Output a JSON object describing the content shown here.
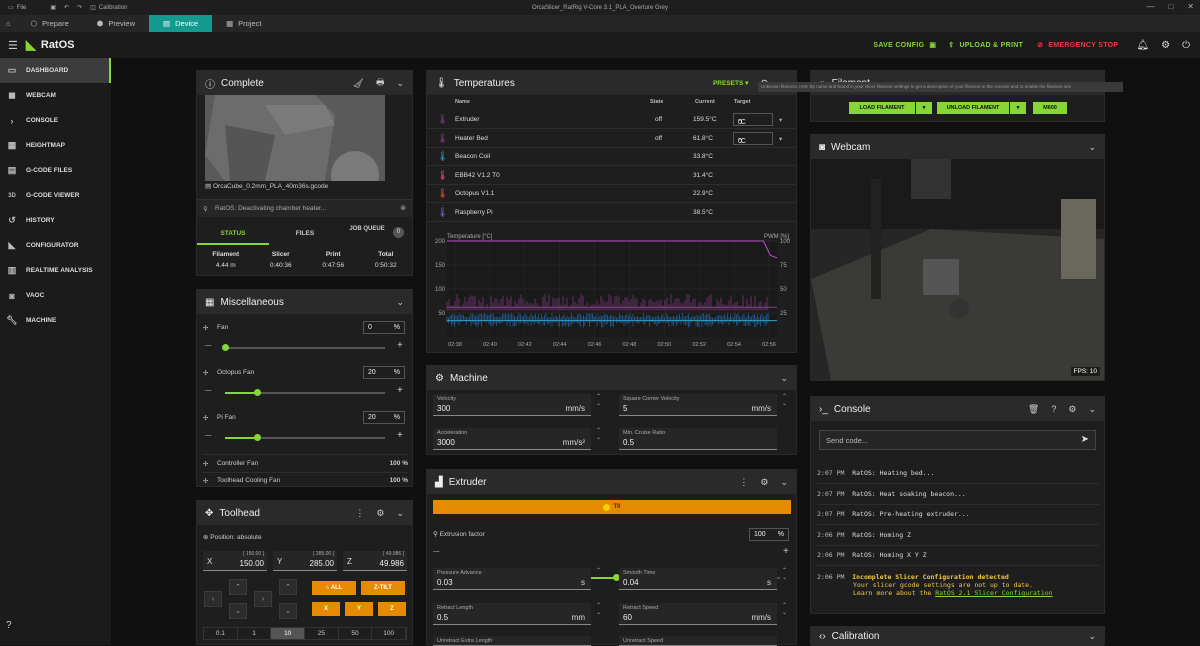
{
  "titlebar": {
    "file": "File",
    "calibration": "Calibration",
    "title": "OrcaSlicer_RatRig V-Core 3.1_PLA_Overture Grey"
  },
  "tabs": [
    {
      "label": "Prepare"
    },
    {
      "label": "Preview"
    },
    {
      "label": "Device"
    },
    {
      "label": "Project"
    }
  ],
  "app": {
    "name": "RatOS",
    "save_config": "SAVE CONFIG",
    "upload_print": "UPLOAD & PRINT",
    "emergency_stop": "EMERGENCY STOP"
  },
  "nav": [
    {
      "label": "DASHBOARD",
      "icon": "dashboard-icon"
    },
    {
      "label": "WEBCAM",
      "icon": "webcam-icon"
    },
    {
      "label": "CONSOLE",
      "icon": "console-icon"
    },
    {
      "label": "HEIGHTMAP",
      "icon": "heightmap-icon"
    },
    {
      "label": "G-CODE FILES",
      "icon": "file-icon"
    },
    {
      "label": "G-CODE VIEWER",
      "icon": "3d-icon"
    },
    {
      "label": "HISTORY",
      "icon": "history-icon"
    },
    {
      "label": "CONFIGURATOR",
      "icon": "configurator-icon"
    },
    {
      "label": "REALTIME ANALYSIS",
      "icon": "analysis-icon"
    },
    {
      "label": "VAOC",
      "icon": "vaoc-icon"
    },
    {
      "label": "MACHINE",
      "icon": "wrench-icon"
    }
  ],
  "status": {
    "title": "Complete",
    "filename": "OrcaCube_0.2mm_PLA_40m36s.gcode",
    "message": "RatOS: Deactivating chamber heater...",
    "tabs": [
      "STATUS",
      "FILES",
      "JOB QUEUE"
    ],
    "job_queue_count": "0",
    "stats": {
      "filament_label": "Filament",
      "filament": "4.44 m",
      "slicer_label": "Slicer",
      "slicer": "0:40:36",
      "print_label": "Print",
      "print": "0:47:56",
      "total_label": "Total",
      "total": "0:50:32"
    }
  },
  "misc": {
    "title": "Miscellaneous",
    "fans": [
      {
        "name": "Fan",
        "value": "0",
        "unit": "%",
        "level": 0
      },
      {
        "name": "Octopus Fan",
        "value": "20",
        "unit": "%",
        "level": 20
      },
      {
        "name": "Pi Fan",
        "value": "20",
        "unit": "%",
        "level": 20
      }
    ],
    "controller_fan": {
      "name": "Controller Fan",
      "value": "100 %"
    },
    "toolhead_fan": {
      "name": "Toolhead Cooling Fan",
      "value": "100 %"
    }
  },
  "toolhead": {
    "title": "Toolhead",
    "position_label": "Position: absolute",
    "axes": [
      {
        "axis": "X",
        "max": "[ 150.00 ]",
        "value": "150.00"
      },
      {
        "axis": "Y",
        "max": "[ 285.00 ]",
        "value": "285.00"
      },
      {
        "axis": "Z",
        "max": "[ 49.986 ]",
        "value": "49.986"
      }
    ],
    "home_all": "ALL",
    "ztilt": "Z-TILT",
    "home_x": "X",
    "home_y": "Y",
    "home_z": "Z",
    "steps": [
      "0.1",
      "1",
      "10",
      "25",
      "50",
      "100"
    ],
    "active_step": "10"
  },
  "temps": {
    "title": "Temperatures",
    "presets": "PRESETS",
    "headers": {
      "name": "Name",
      "state": "State",
      "current": "Current",
      "target": "Target"
    },
    "rows": [
      {
        "name": "Extruder",
        "state": "off",
        "current": "159.5°C",
        "target": "0",
        "unit": "°C",
        "color": "#8a3f8c"
      },
      {
        "name": "Heater Bed",
        "state": "off",
        "current": "61.8°C",
        "target": "0",
        "unit": "°C",
        "color": "#8a3f8c"
      },
      {
        "name": "Beacon Coil",
        "state": "",
        "current": "33.8°C",
        "target": "",
        "unit": "",
        "color": "#26a6c9"
      },
      {
        "name": "EBB42 V1.2 T0",
        "state": "",
        "current": "31.4°C",
        "target": "",
        "unit": "",
        "color": "#e05a8c"
      },
      {
        "name": "Octopus V1.1",
        "state": "",
        "current": "22.9°C",
        "target": "",
        "unit": "",
        "color": "#e8553a"
      },
      {
        "name": "Raspberry Pi",
        "state": "",
        "current": "38.5°C",
        "target": "",
        "unit": "",
        "color": "#6a6ad8"
      }
    ],
    "chart_data": {
      "type": "line",
      "ylabel": "Temperature [°C]",
      "y2label": "PWM [%]",
      "ylim": [
        0,
        200
      ],
      "y2lim": [
        0,
        100
      ],
      "yticks": [
        "200",
        "150",
        "100",
        "50"
      ],
      "y2ticks": [
        "100",
        "75",
        "50",
        "25"
      ],
      "xticks": [
        "02:38",
        "02:40",
        "02:42",
        "02:44",
        "02:46",
        "02:48",
        "02:50",
        "02:52",
        "02:54",
        "02:56"
      ],
      "series": [
        {
          "name": "Extruder",
          "color": "#c04bcf",
          "values": [
            200,
            200,
            200,
            200,
            200,
            200,
            200,
            200,
            200,
            200,
            200,
            200,
            200,
            200,
            200,
            200,
            200,
            200,
            200,
            200,
            200,
            200,
            200,
            200,
            200,
            200,
            200,
            200,
            200,
            200,
            200,
            200,
            200,
            200,
            200,
            200,
            200,
            200,
            200,
            200,
            200,
            200,
            200,
            200,
            200,
            200,
            200,
            200,
            170,
            165
          ]
        },
        {
          "name": "Heater Bed",
          "color": "#8a3f8c",
          "values": [
            62,
            62,
            62,
            62,
            62,
            62,
            62,
            62,
            62,
            62,
            62,
            62,
            62,
            62,
            62,
            62,
            62,
            62,
            62,
            62,
            62,
            62,
            62,
            62,
            62,
            62,
            62,
            62,
            62,
            62,
            62,
            62,
            62,
            62,
            62,
            62,
            62,
            62,
            62,
            62,
            62,
            62,
            62,
            62,
            62,
            62,
            62,
            62,
            62,
            62
          ]
        },
        {
          "name": "Beacon Coil",
          "color": "#26a6c9",
          "values": [
            34,
            34,
            34,
            34,
            34,
            34,
            34,
            34,
            34,
            34,
            34,
            34,
            34,
            34,
            34,
            34,
            34,
            34,
            34,
            34,
            34,
            34,
            34,
            34,
            34,
            34,
            34,
            34,
            34,
            34,
            34,
            34,
            34,
            34,
            34,
            34,
            34,
            34,
            34,
            34,
            34,
            34,
            34,
            34,
            34,
            34,
            34,
            34,
            34,
            34
          ]
        }
      ]
    }
  },
  "machine": {
    "title": "Machine",
    "velocity_label": "Velocity",
    "velocity": "300",
    "velocity_unit": "mm/s",
    "scv_label": "Square Corner Velocity",
    "scv": "5",
    "scv_unit": "mm/s",
    "accel_label": "Acceleration",
    "accel": "3000",
    "accel_unit": "mm/s²",
    "mcr_label": "Min. Cruise Ratio",
    "mcr": "0.5"
  },
  "extruder": {
    "title": "Extruder",
    "tool": "T0",
    "factor_label": "Extrusion factor",
    "factor": "100",
    "factor_unit": "%",
    "factor_level": 100,
    "factor_max": 200,
    "pa_label": "Pressure Advance",
    "pa": "0.03",
    "pa_unit": "s",
    "st_label": "Smooth Time",
    "st": "0.04",
    "st_unit": "s",
    "rl_label": "Retract Length",
    "rl": "0.5",
    "rl_unit": "mm",
    "rs_label": "Retract Speed",
    "rs": "60",
    "rs_unit": "mm/s",
    "uel_label": "Unretract Extra Length",
    "us_label": "Unretract Speed"
  },
  "filament": {
    "title": "Filament",
    "load": "LOAD FILAMENT",
    "unload": "UNLOAD FILAMENT",
    "m600": "M600",
    "tooltip": "Unknown filament. Hint: By name and brand in your slicer filament settings to get a description of your filament in the console and to enable the filament info"
  },
  "webcam": {
    "title": "Webcam",
    "fps": "FPS: 10"
  },
  "console": {
    "title": "Console",
    "placeholder": "Send code...",
    "logs": [
      {
        "time": "2:07 PM",
        "text": "RatOS: Heating bed..."
      },
      {
        "time": "2:07 PM",
        "text": "RatOS: Heat soaking beacon..."
      },
      {
        "time": "2:07 PM",
        "text": "RatOS: Pre-heating extruder..."
      },
      {
        "time": "2:06 PM",
        "text": "RatOS: Homing Z"
      },
      {
        "time": "2:06 PM",
        "text": "RatOS: Homing X Y Z"
      }
    ],
    "warning": {
      "time": "2:06 PM",
      "title": "Incomplete Slicer Configuration detected",
      "line1": "Your slicer gcode settings are not up to date.",
      "line2_pre": "Learn more about the ",
      "link": "RatOS 2.1 Slicer Configuration"
    }
  },
  "calibration": {
    "title": "Calibration"
  }
}
